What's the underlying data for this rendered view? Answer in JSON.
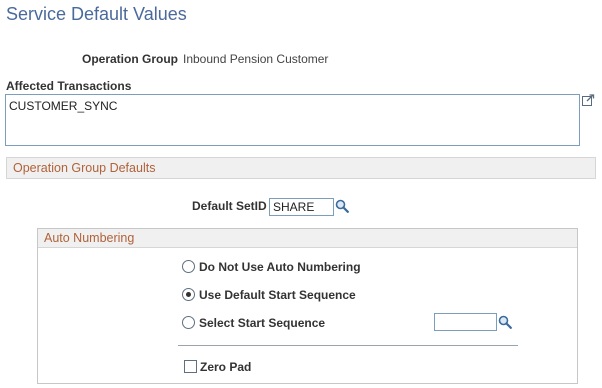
{
  "page": {
    "title": "Service Default Values"
  },
  "operation_group": {
    "label": "Operation Group",
    "value": "Inbound Pension Customer"
  },
  "affected_transactions": {
    "label": "Affected Transactions",
    "value": "CUSTOMER_SYNC"
  },
  "operation_group_defaults": {
    "header": "Operation Group Defaults"
  },
  "default_setid": {
    "label": "Default SetID",
    "value": "SHARE"
  },
  "auto_numbering": {
    "header": "Auto Numbering",
    "options": [
      {
        "label": "Do Not Use Auto Numbering",
        "checked": false
      },
      {
        "label": "Use Default Start Sequence",
        "checked": true
      },
      {
        "label": "Select Start Sequence",
        "checked": false
      }
    ],
    "start_sequence_value": "",
    "zero_pad": {
      "label": "Zero Pad",
      "checked": false
    }
  },
  "icons": {
    "expand": "expand-icon",
    "lookup": "magnifier-lookup-icon"
  },
  "colors": {
    "title": "#4a6a9c",
    "section_header_text": "#b0623a",
    "section_header_bg": "#f0f0f0",
    "field_border": "#7b9ebd"
  }
}
